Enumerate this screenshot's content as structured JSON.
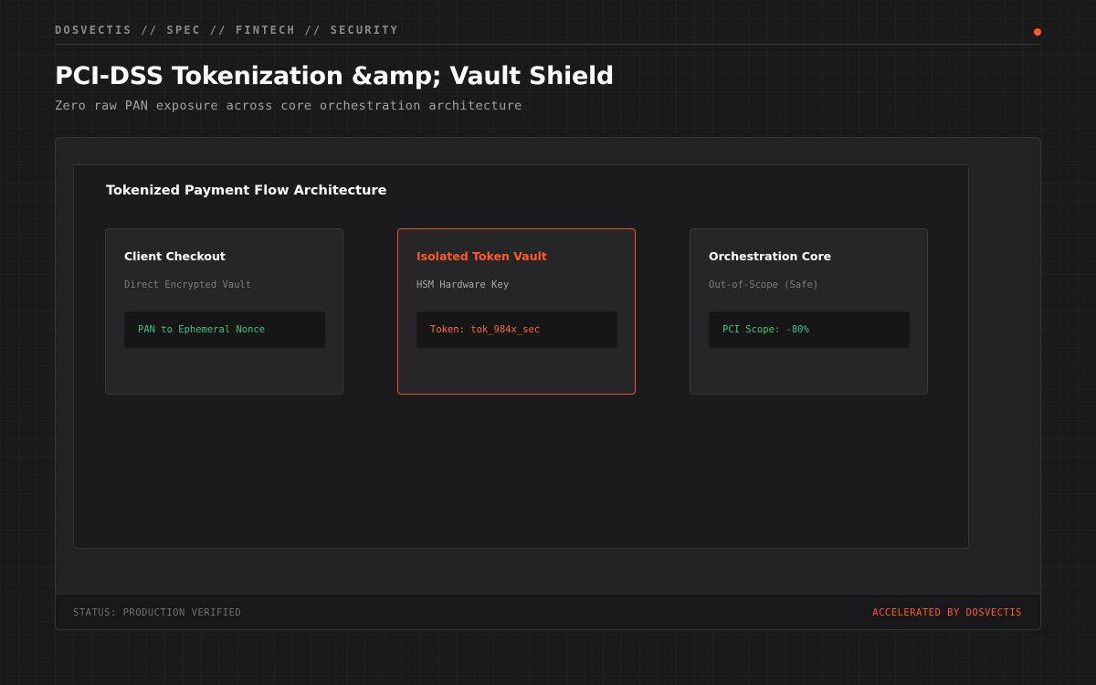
{
  "header": {
    "breadcrumb": "DOSVECTIS // SPEC // FINTECH // SECURITY",
    "title": "PCI-DSS Tokenization &amp; Vault Shield",
    "subtitle": "Zero raw PAN exposure across core orchestration architecture"
  },
  "diagram": {
    "title": "Tokenized Payment Flow Architecture",
    "cards": [
      {
        "title": "Client Checkout",
        "subtitle": "Direct Encrypted Vault",
        "code": "PAN to Ephemeral Nonce"
      },
      {
        "title": "Isolated Token Vault",
        "subtitle": "HSM Hardware Key",
        "code": "Token: tok_984x_sec"
      },
      {
        "title": "Orchestration Core",
        "subtitle": "Out-of-Scope (Safe)",
        "code": "PCI Scope: -80%"
      }
    ]
  },
  "footer": {
    "status": "STATUS: PRODUCTION VERIFIED",
    "brand": "ACCELERATED BY DOSVECTIS"
  },
  "colors": {
    "accent": "#ff5a1f",
    "success": "#3bc47a",
    "background": "#1a1a1b"
  }
}
